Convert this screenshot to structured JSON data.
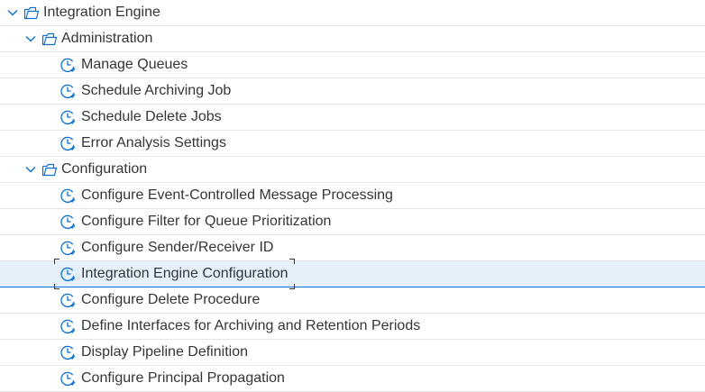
{
  "tree": {
    "root": {
      "label": "Integration Engine",
      "icon": "folder-open-icon",
      "expanded": true
    },
    "groups": [
      {
        "label": "Administration",
        "icon": "folder-open-icon",
        "expanded": true,
        "items": [
          {
            "label": "Manage Queues",
            "icon": "clock-icon"
          },
          {
            "label": "Schedule Archiving Job",
            "icon": "clock-icon"
          },
          {
            "label": "Schedule Delete Jobs",
            "icon": "clock-icon"
          },
          {
            "label": "Error Analysis Settings",
            "icon": "clock-icon"
          }
        ]
      },
      {
        "label": "Configuration",
        "icon": "folder-open-icon",
        "expanded": true,
        "items": [
          {
            "label": "Configure Event-Controlled Message Processing",
            "icon": "clock-icon"
          },
          {
            "label": "Configure Filter for Queue Prioritization",
            "icon": "clock-icon"
          },
          {
            "label": "Configure Sender/Receiver ID",
            "icon": "clock-icon"
          },
          {
            "label": "Integration Engine Configuration",
            "icon": "clock-icon",
            "selected": true
          },
          {
            "label": "Configure Delete Procedure",
            "icon": "clock-icon"
          },
          {
            "label": "Define Interfaces for Archiving and Retention Periods",
            "icon": "clock-icon"
          },
          {
            "label": "Display Pipeline Definition",
            "icon": "clock-icon"
          },
          {
            "label": "Configure Principal Propagation",
            "icon": "clock-icon"
          }
        ]
      }
    ]
  },
  "colors": {
    "icon": "#0a6ed1",
    "text": "#32363a",
    "selected_background": "#e5f0fa",
    "selected_border": "#0a6ed1",
    "row_divider": "#e5e5e5"
  }
}
